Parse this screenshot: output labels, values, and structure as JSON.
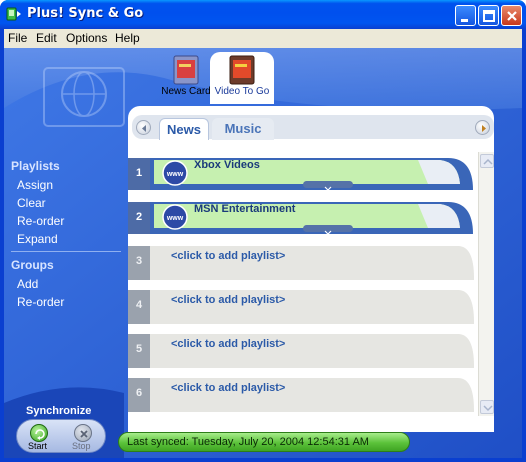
{
  "window": {
    "title": "Plus! Sync & Go"
  },
  "menu": {
    "items": [
      "File",
      "Edit",
      "Options",
      "Help"
    ]
  },
  "devices": [
    {
      "label": "News Card",
      "active": false
    },
    {
      "label": "Video To Go",
      "active": true
    }
  ],
  "tabs": [
    {
      "label": "News",
      "active": true
    },
    {
      "label": "Music",
      "active": false
    }
  ],
  "sidebar": {
    "playlists_heading": "Playlists",
    "playlist_items": [
      "Assign",
      "Clear",
      "Re-order",
      "Expand"
    ],
    "groups_heading": "Groups",
    "group_items": [
      "Add",
      "Re-order"
    ]
  },
  "rows": [
    {
      "num": "1",
      "label": "Xbox Videos",
      "filled": true
    },
    {
      "num": "2",
      "label": "MSN Entertainment",
      "filled": true
    },
    {
      "num": "3",
      "label": "<click to add playlist>",
      "filled": false
    },
    {
      "num": "4",
      "label": "<click to add playlist>",
      "filled": false
    },
    {
      "num": "5",
      "label": "<click to add playlist>",
      "filled": false
    },
    {
      "num": "6",
      "label": "<click to add playlist>",
      "filled": false
    }
  ],
  "status": {
    "text": "Last synced: Tuesday, July 20, 2004 12:54:31 AM"
  },
  "sync": {
    "title": "Synchronize",
    "start_label": "Start",
    "stop_label": "Stop"
  },
  "colors": {
    "title_blue": "#0053ee",
    "panel_blue": "#2d63d8",
    "status_green": "#5bc23a",
    "link_blue": "#2b5aa8"
  }
}
